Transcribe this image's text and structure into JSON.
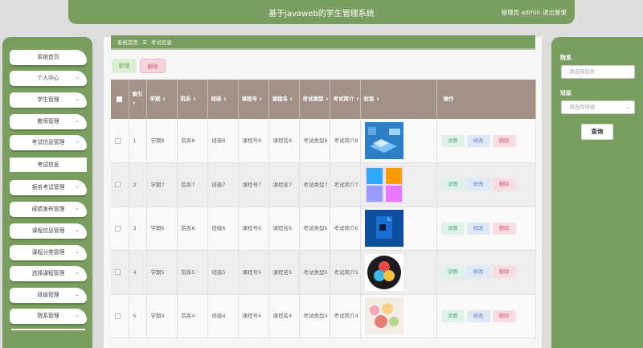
{
  "header": {
    "title": "基于javaweb的学生管理系统",
    "user_role": "管理员",
    "user_name": "admin",
    "logout": "退出登录"
  },
  "sidebar": {
    "items": [
      {
        "label": "系统首页",
        "chevron": false
      },
      {
        "label": "个人中心",
        "chevron": true
      },
      {
        "label": "学生管理",
        "chevron": true
      },
      {
        "label": "教师管理",
        "chevron": true
      },
      {
        "label": "考试信息管理",
        "chevron": true,
        "expanded": true
      },
      {
        "label": "报名考试管理",
        "chevron": true
      },
      {
        "label": "成绩发布管理",
        "chevron": true
      },
      {
        "label": "课程信息管理",
        "chevron": true
      },
      {
        "label": "课程分类管理",
        "chevron": true
      },
      {
        "label": "选择课程管理",
        "chevron": true
      },
      {
        "label": "班级管理",
        "chevron": true
      },
      {
        "label": "院系管理",
        "chevron": true
      }
    ],
    "submenu": {
      "label": "考试信息"
    }
  },
  "breadcrumb": {
    "home": "系统首页",
    "separator": "☰",
    "current": "考试信息"
  },
  "toolbar": {
    "add_label": "新增",
    "delete_label": "删除"
  },
  "table": {
    "headers": {
      "index": "索引",
      "term": "学期",
      "department": "院系",
      "class": "班级",
      "course_no": "课程号",
      "course_name": "课程名",
      "exam_type": "考试类型",
      "exam_intro": "考试简介",
      "cover": "封面",
      "actions": "操作"
    },
    "rows": [
      {
        "index": "1",
        "term": "学期8",
        "department": "院系8",
        "class": "班级8",
        "course_no": "课程号8",
        "course_name": "课程名8",
        "exam_type": "考试类型8",
        "exam_intro": "考试简介8",
        "cover_icon": "isometric-app-icon"
      },
      {
        "index": "2",
        "term": "学期7",
        "department": "院系7",
        "class": "班级7",
        "course_no": "课程号7",
        "course_name": "课程名7",
        "exam_type": "考试类型7",
        "exam_intro": "考试简介7",
        "cover_icon": "adobe-apps-icon"
      },
      {
        "index": "3",
        "term": "学期6",
        "department": "院系6",
        "class": "班级6",
        "course_no": "课程号6",
        "course_name": "课程名6",
        "exam_type": "考试类型6",
        "exam_intro": "考试简介6",
        "cover_icon": "photoshop-doc-icon"
      },
      {
        "index": "4",
        "term": "学期5",
        "department": "院系5",
        "class": "班级5",
        "course_no": "课程号5",
        "course_name": "课程名5",
        "exam_type": "考试类型5",
        "exam_intro": "考试简介5",
        "cover_icon": "davinci-resolve-icon"
      },
      {
        "index": "5",
        "term": "学期4",
        "department": "院系4",
        "class": "班级4",
        "course_no": "课程号4",
        "course_name": "课程名4",
        "exam_type": "考试类型4",
        "exam_intro": "考试简介4",
        "cover_icon": "food-photo-icon"
      }
    ],
    "actions": {
      "detail": "详情",
      "edit": "修改",
      "delete": "删除"
    }
  },
  "search": {
    "department_label": "院系",
    "department_placeholder": "请选择院系",
    "class_label": "班级",
    "class_placeholder": "请选择班级",
    "button": "查询"
  },
  "colors": {
    "accent": "#7a9e5f",
    "table_header": "#a19187"
  }
}
